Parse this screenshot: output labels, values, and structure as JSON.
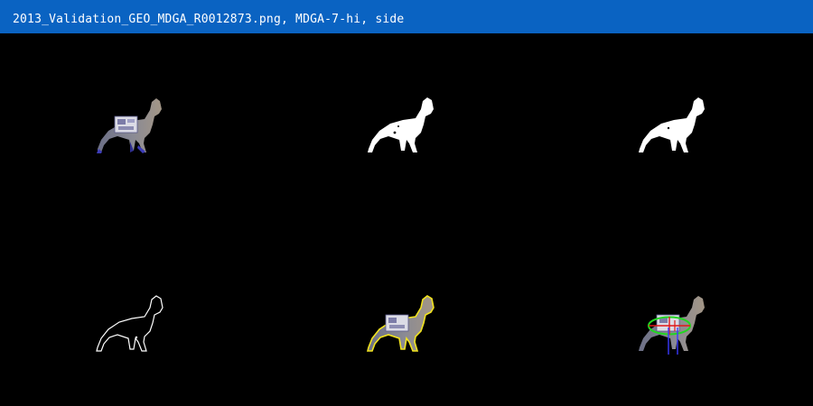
{
  "window": {
    "title": "2013_Validation_GEO_MDGA_R0012873.png, MDGA-7-hi, side"
  },
  "colors": {
    "title_bar": "#0a63c2",
    "background": "#000000",
    "mask": "#ffffff",
    "outline_yellow": "#f2e41e",
    "ellipse_green": "#22d622",
    "marker_red": "#e01818",
    "marker_blue": "#3a3aff"
  },
  "panels": [
    {
      "name": "original-photo",
      "view": "side"
    },
    {
      "name": "binary-mask",
      "view": "side"
    },
    {
      "name": "cleaned-mask",
      "view": "side"
    },
    {
      "name": "contour-outline",
      "view": "side"
    },
    {
      "name": "contour-overlay",
      "view": "side"
    },
    {
      "name": "measurement-overlay",
      "view": "side"
    }
  ]
}
